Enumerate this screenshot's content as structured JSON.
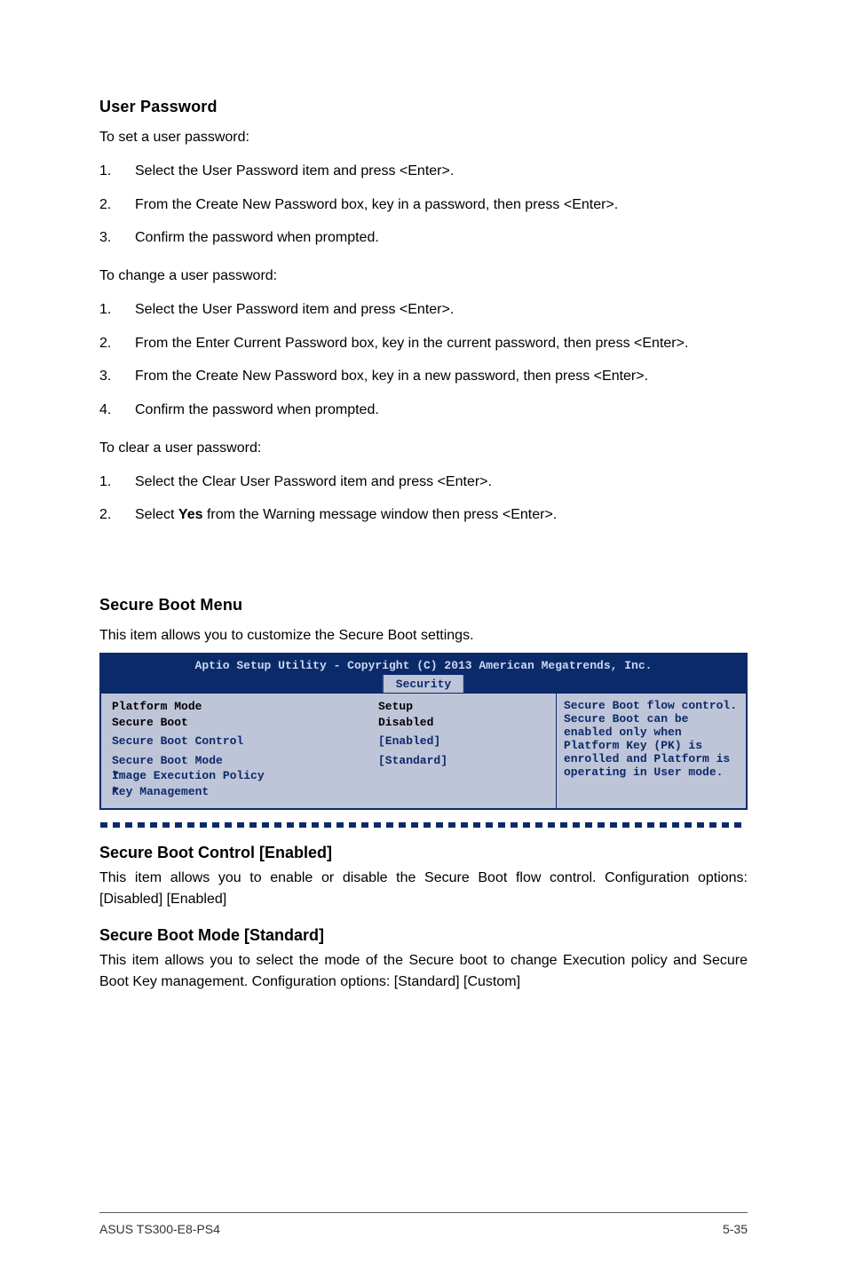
{
  "headings": {
    "user_password": "User Password",
    "secure_boot_menu": "Secure Boot Menu",
    "secure_boot_control": "Secure Boot Control [Enabled]",
    "secure_boot_mode": "Secure Boot Mode [Standard]"
  },
  "paragraphs": {
    "set_user_pw": "To set a user password:",
    "change_user_pw": "To change a user password:",
    "clear_user_pw": "To clear a user password:",
    "secure_boot_menu_desc": "This item allows you to customize the Secure Boot settings.",
    "secure_boot_control_desc": "This item allows you to enable or disable the Secure Boot flow control. Configuration options: [Disabled] [Enabled]",
    "secure_boot_mode_desc": "This item allows you to select the mode of the Secure boot to change Execution policy and Secure Boot Key management. Configuration options: [Standard] [Custom]"
  },
  "lists": {
    "set_pw": [
      {
        "num": "1.",
        "text": "Select the User Password item and press <Enter>."
      },
      {
        "num": "2.",
        "text": "From the Create New Password box, key in a password, then press <Enter>."
      },
      {
        "num": "3.",
        "text": "Confirm the password when prompted."
      }
    ],
    "change_pw": [
      {
        "num": "1.",
        "text": "Select the User Password item and press <Enter>."
      },
      {
        "num": "2.",
        "text": "From the Enter Current Password box, key in the current password, then press <Enter>."
      },
      {
        "num": "3.",
        "text": "From the Create New Password box, key in a new password, then press <Enter>."
      },
      {
        "num": "4.",
        "text": "Confirm the password when prompted."
      }
    ],
    "clear_pw": [
      {
        "num": "1.",
        "text": "Select the Clear User Password item and press <Enter>."
      },
      {
        "num": "2.",
        "text": "Select Yes from the Warning message window then press <Enter>."
      }
    ]
  },
  "bios": {
    "title": "Aptio Setup Utility - Copyright (C) 2013 American Megatrends, Inc.",
    "tab": "Security",
    "fields": {
      "platform_mode_label": "Platform Mode",
      "platform_mode_value": "Setup",
      "secure_boot_label": "Secure Boot",
      "secure_boot_value": "Disabled",
      "secure_boot_control_label": "Secure Boot Control",
      "secure_boot_control_value": "[Enabled]",
      "secure_boot_mode_label": "Secure Boot Mode",
      "secure_boot_mode_value": "[Standard]",
      "image_exec_policy": "Image Execution Policy",
      "key_management": "Key Management"
    },
    "help": {
      "l1": "Secure Boot flow control.",
      "l2": "Secure Boot can be",
      "l3": "enabled only when",
      "l4": "Platform Key (PK) is",
      "l5": "enrolled and Platform is",
      "l6": "operating in User mode."
    }
  },
  "footer": {
    "product": "ASUS TS300-E8-PS4",
    "page": "5-35"
  }
}
